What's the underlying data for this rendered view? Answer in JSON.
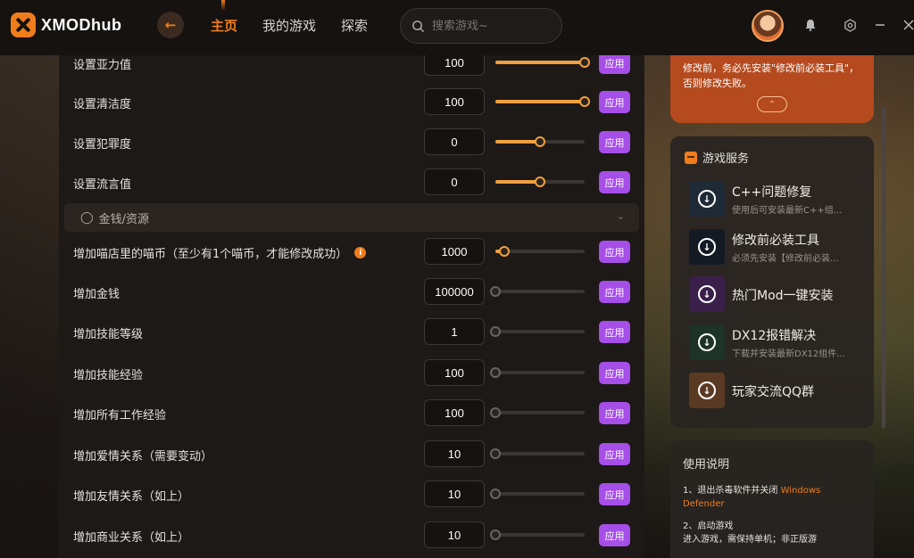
{
  "app": {
    "logo_text": "XMODhub",
    "nav": [
      "主页",
      "我的游戏",
      "探索"
    ],
    "search_placeholder": "搜索游戏~"
  },
  "rows": [
    {
      "label": "设置亚力值",
      "value": "100",
      "slider": 1.0
    },
    {
      "label": "设置清洁度",
      "value": "100",
      "slider": 1.0
    },
    {
      "label": "设置犯罪度",
      "value": "0",
      "slider": 0.5
    },
    {
      "label": "设置流言值",
      "value": "0",
      "slider": 0.5
    },
    {
      "label": "增加喵店里的喵币（至少有1个喵币，才能修改成功）",
      "value": "1000",
      "slider": 0.1,
      "info": true
    },
    {
      "label": "增加金钱",
      "value": "100000",
      "slider": 0
    },
    {
      "label": "增加技能等级",
      "value": "1",
      "slider": 0
    },
    {
      "label": "增加技能经验",
      "value": "100",
      "slider": 0
    },
    {
      "label": "增加所有工作经验",
      "value": "100",
      "slider": 0
    },
    {
      "label": "增加爱情关系（需要变动）",
      "value": "10",
      "slider": 0
    },
    {
      "label": "增加友情关系（如上）",
      "value": "10",
      "slider": 0
    },
    {
      "label": "增加商业关系（如上）",
      "value": "10",
      "slider": 0
    }
  ],
  "apply_label": "应用",
  "section_header": "金钱/资源",
  "warning": {
    "text_line1": "修改前，务必先安装\"修改前必装工具\"，",
    "text_line2": "否则修改失败。"
  },
  "services": {
    "title": "游戏服务",
    "items": [
      {
        "name": "C++问题修复",
        "desc": "使用后可安装最新C++组...",
        "color": "#1e2a36"
      },
      {
        "name": "修改前必装工具",
        "desc": "必须先安装【修改前必装...",
        "color": "#141a24"
      },
      {
        "name": "热门Mod一键安装",
        "desc": "",
        "color": "#3a1f4a"
      },
      {
        "name": "DX12报错解决",
        "desc": "下载并安装最新DX12组件...",
        "color": "#1e3328"
      },
      {
        "name": "玩家交流QQ群",
        "desc": "",
        "color": "#5a3a22"
      }
    ]
  },
  "guide": {
    "title": "使用说明",
    "step1": "1、退出杀毒软件并关闭",
    "step1_hl": "Windows Defender",
    "step2": "2、启动游戏",
    "step2_more": "进入游戏，需保持单机；非正版游"
  }
}
